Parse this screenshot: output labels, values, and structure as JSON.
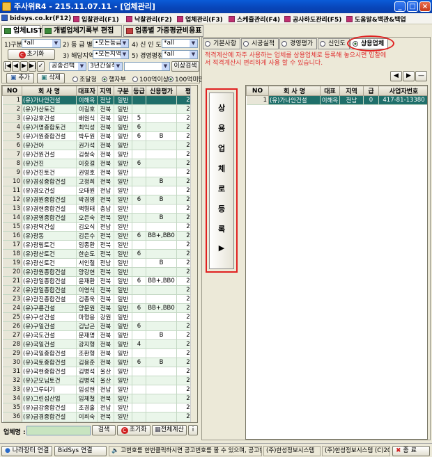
{
  "window": {
    "title": "주사위R4 - 215.11.07.11 - [업체관리]"
  },
  "menu": [
    {
      "label": "bidsys.co.kr(F12)"
    },
    {
      "label": "입찰관리(F1)"
    },
    {
      "label": "낙찰관리(F2)"
    },
    {
      "label": "업체관리(F3)"
    },
    {
      "label": "스케쥴관리(F4)"
    },
    {
      "label": "공사하도관리(F5)"
    },
    {
      "label": "도움말&백관&백업"
    }
  ],
  "main_tabs": [
    {
      "label": "업체LIST"
    },
    {
      "label": "개별업체기록부 편집"
    },
    {
      "label": "업종별 가중평균비용표"
    }
  ],
  "filters": {
    "f1_label": "1)구분",
    "f1_value": "*all",
    "f2_label": "2) 등 급 별",
    "f2_value": "•모든등급",
    "f4_label": "4) 신 인 도",
    "f4_value": "*all",
    "f3_label": "3) 해당지역",
    "f3_value": "•모든지역",
    "f5_label": "5) 경영평점",
    "f5_value": "*all",
    "reset": "초기화",
    "sort_value": "공종선택",
    "period_value": "3년간실적",
    "amount_value": "0",
    "amount_btn": "이상검색",
    "add": "추가",
    "delete": "삭제",
    "r1": "조달청",
    "r2": "행자부",
    "r3": "100억이상",
    "r4": "100억미만"
  },
  "left_grid": {
    "columns": [
      "NO",
      "회 사 명",
      "대표자",
      "지역",
      "구분",
      "등급",
      "신용평가",
      "평"
    ],
    "rows": [
      [
        "1",
        "(유)가나안건설",
        "이해옥",
        "전남",
        "일반",
        "",
        "",
        "2"
      ],
      [
        "2",
        "(유)가산토건",
        "이길호",
        "전북",
        "일반",
        "",
        "",
        "2"
      ],
      [
        "3",
        "(유)강호건설",
        "배원식",
        "전북",
        "일반",
        "5",
        "",
        "2"
      ],
      [
        "4",
        "(유)거명종합토건",
        "최익성",
        "전북",
        "일반",
        "6",
        "",
        "2"
      ],
      [
        "5",
        "(유)거원종합건설",
        "박두원",
        "전북",
        "일반",
        "6",
        "B",
        "2"
      ],
      [
        "6",
        "(유)건아",
        "권가석",
        "전북",
        "일반",
        "",
        "",
        "2"
      ],
      [
        "7",
        "(유)건원건설",
        "김쌍숙",
        "전북",
        "일반",
        "",
        "",
        "2"
      ],
      [
        "8",
        "(유)건진",
        "이흥걸",
        "전북",
        "일반",
        "6",
        "",
        "2"
      ],
      [
        "9",
        "(유)건진토건",
        "권영호",
        "전북",
        "일반",
        "",
        "",
        "2"
      ],
      [
        "10",
        "(유)경성종합건설",
        "고정희",
        "전북",
        "일반",
        "",
        "B",
        "2"
      ],
      [
        "11",
        "(유)경오건설",
        "오태원",
        "전남",
        "일반",
        "",
        "",
        "2"
      ],
      [
        "12",
        "(유)경원종합건설",
        "박경영",
        "전북",
        "일반",
        "6",
        "B",
        "2"
      ],
      [
        "13",
        "(유)경현종합건설",
        "백형태",
        "충남",
        "일반",
        "",
        "",
        "2"
      ],
      [
        "14",
        "(유)공영종합건설",
        "오은숙",
        "전북",
        "일반",
        "",
        "B",
        "2"
      ],
      [
        "15",
        "(유)광덕건설",
        "김오식",
        "전남",
        "일반",
        "",
        "",
        "2"
      ],
      [
        "16",
        "(유)광동",
        "김은수",
        "전북",
        "일반",
        "6",
        "BB+,BB0",
        "2"
      ],
      [
        "17",
        "(유)광림토건",
        "임종환",
        "전북",
        "일반",
        "",
        "",
        "2"
      ],
      [
        "18",
        "(유)광산토건",
        "한순도",
        "전북",
        "일반",
        "6",
        "",
        "2"
      ],
      [
        "19",
        "(유)광신토건",
        "서인철",
        "전남",
        "일반",
        "",
        "B",
        "2"
      ],
      [
        "20",
        "(유)광원종합건설",
        "양강현",
        "전북",
        "일반",
        "",
        "",
        "2"
      ],
      [
        "21",
        "(유)광일종합건설",
        "윤재환",
        "전북",
        "일반",
        "6",
        "BB+,BB0",
        "2"
      ],
      [
        "22",
        "(유)광일종합건설",
        "이영식",
        "전북",
        "일반",
        "",
        "",
        "2"
      ],
      [
        "23",
        "(유)광진종합건설",
        "김종욱",
        "전북",
        "일반",
        "",
        "",
        "2"
      ],
      [
        "24",
        "(유)구룡건설",
        "양문원",
        "전북",
        "일반",
        "6",
        "BB+,BB0",
        "2"
      ],
      [
        "25",
        "(유)구성건설",
        "마형용",
        "강원",
        "일반",
        "",
        "",
        "2"
      ],
      [
        "26",
        "(유)구일건설",
        "김남곤",
        "전북",
        "일반",
        "6",
        "",
        "2"
      ],
      [
        "27",
        "(유)국도건설",
        "문재명",
        "전북",
        "일반",
        "",
        "B",
        "2"
      ],
      [
        "28",
        "(유)국일건설",
        "강지형",
        "전북",
        "일반",
        "4",
        "",
        "2"
      ],
      [
        "29",
        "(유)국일종합건설",
        "조환형",
        "전북",
        "일반",
        "",
        "",
        "2"
      ],
      [
        "30",
        "(유)국토종합건설",
        "김용준",
        "전북",
        "일반",
        "6",
        "B",
        "2"
      ],
      [
        "31",
        "(유)국현종합건설",
        "김병석",
        "울산",
        "일반",
        "",
        "",
        "2"
      ],
      [
        "32",
        "(유)군모님토건",
        "김병석",
        "울산",
        "일반",
        "",
        "",
        "2"
      ],
      [
        "33",
        "(유)그루터기",
        "임성현",
        "전남",
        "일반",
        "",
        "",
        "2"
      ],
      [
        "34",
        "(유)그린섬산업",
        "임체철",
        "전북",
        "일반",
        "",
        "",
        "2"
      ],
      [
        "35",
        "(유)금강종합건설",
        "조경홀",
        "전남",
        "일반",
        "",
        "",
        "2"
      ],
      [
        "36",
        "(유)금경종합건설",
        "이희숙",
        "전북",
        "일반",
        "",
        "",
        "2"
      ],
      [
        "37",
        "(유)금동종합건설",
        "장한석",
        "전북",
        "일반",
        "",
        "B",
        "2"
      ],
      [
        "38",
        "(유)금록건설",
        "서철수",
        "전북",
        "일반",
        "6",
        "BB+,BB0",
        "2"
      ],
      [
        "39",
        "(유)금명건설",
        "강은숙",
        "전북",
        "일반",
        "",
        "",
        "2"
      ],
      [
        "40",
        "(유)금오건설",
        "조금형",
        "전북",
        "일반",
        "5",
        "",
        "2"
      ],
      [
        "41",
        "(유)금용종합건설",
        "정철건",
        "광주",
        "일반",
        "6",
        "",
        "2"
      ],
      [
        "42",
        "(유)기반종합건설",
        "이맥섭",
        "전북",
        "일반",
        "",
        "",
        "2"
      ]
    ]
  },
  "bottom_left": {
    "label": "업체명 :",
    "search": "검색",
    "reset": "초기화",
    "calc": "전체계산",
    "info": "i"
  },
  "right_tabs": [
    {
      "label": "기본사항"
    },
    {
      "label": "시공실적"
    },
    {
      "label": "경영평가"
    },
    {
      "label": "신인도"
    },
    {
      "label": "상용업체"
    }
  ],
  "right_desc": "적격계산에 자주 사용하는 업체를 상용업체로 등록해 놓으시면 입찰에서 적격계산시 편리하게 사용 할 수 있습니다.",
  "nav_buttons": {
    "prev": "◀",
    "next": "▶",
    "minus": "—"
  },
  "register_button": {
    "chars": [
      "상",
      "용",
      "업",
      "체",
      "로",
      "등",
      "록",
      "▶"
    ]
  },
  "right_grid": {
    "columns": [
      "NO",
      "회 사 명",
      "대표",
      "지역",
      "급",
      "사업자번호"
    ],
    "rows": [
      [
        "1",
        "(유)가나안건설",
        "이해옥",
        "전남",
        "0",
        "417-81-13380"
      ]
    ]
  },
  "status": {
    "b1": "나라장터 연결",
    "b2": "BidSys 연결",
    "msg": "고번호를 한번클릭하시면 공고번호를 볼 수 있으며, 공고번호",
    "co1": "(주)한성정보시스템",
    "co2": "(주)한성정보시스템 (C)2008",
    "exit": "종 료"
  }
}
